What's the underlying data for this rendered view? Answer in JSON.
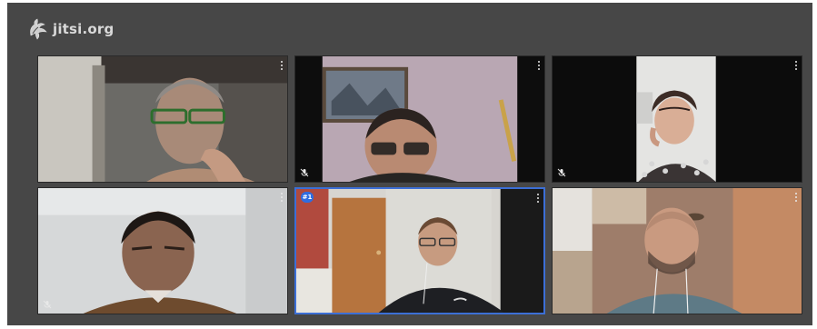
{
  "app": {
    "brand": "jitsi.org",
    "accent_color": "#3c6fd6"
  },
  "participants": [
    {
      "id": "p1",
      "muted": false,
      "active": false,
      "badge": ""
    },
    {
      "id": "p2",
      "muted": true,
      "active": false,
      "badge": ""
    },
    {
      "id": "p3",
      "muted": true,
      "active": false,
      "badge": ""
    },
    {
      "id": "p4",
      "muted": true,
      "active": false,
      "badge": ""
    },
    {
      "id": "p5",
      "muted": false,
      "active": true,
      "badge": "#1"
    },
    {
      "id": "p6",
      "muted": false,
      "active": false,
      "badge": ""
    }
  ],
  "icons": {
    "brand": "jitsi-logo-icon",
    "menu": "more-vertical-icon",
    "muted": "mic-muted-icon"
  }
}
